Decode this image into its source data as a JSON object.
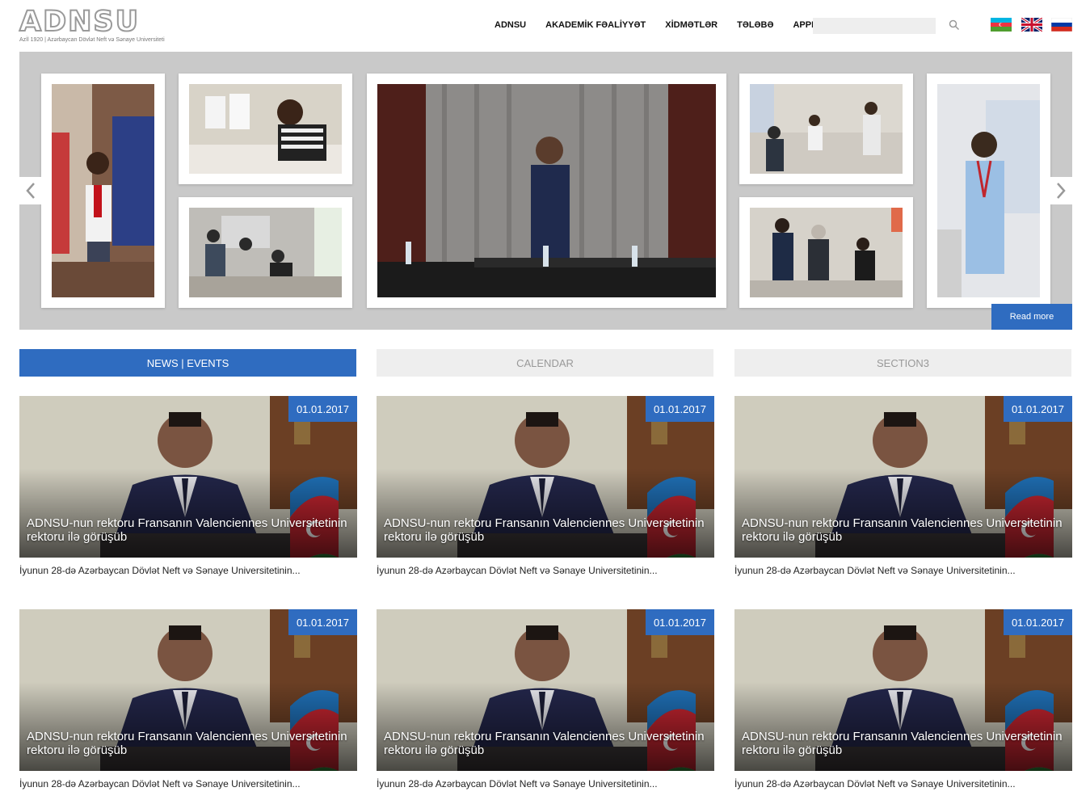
{
  "logo": {
    "mark": "ADNSU",
    "subtitle": "Azİl 1920 | Azərbaycan Dövlət Neft və Sənaye Universiteti"
  },
  "nav": {
    "items": [
      {
        "label": "ADNSU"
      },
      {
        "label": "AKADEMİK FƏALİYYƏT"
      },
      {
        "label": "XİDMƏTLƏR"
      },
      {
        "label": "TƏLƏBƏ"
      },
      {
        "label": "APPLY"
      }
    ]
  },
  "search": {
    "placeholder": "",
    "icon": "search-icon"
  },
  "languages": [
    {
      "code": "az",
      "icon": "flag-azerbaijan-icon"
    },
    {
      "code": "en",
      "icon": "flag-uk-icon"
    },
    {
      "code": "ru",
      "icon": "flag-russia-icon"
    }
  ],
  "slider": {
    "read_more_label": "Read more",
    "prev_icon": "chevron-left-icon",
    "next_icon": "chevron-right-icon"
  },
  "tabs": [
    {
      "label": "NEWS | EVENTS",
      "active": true
    },
    {
      "label": "CALENDAR",
      "active": false
    },
    {
      "label": "SECTION3",
      "active": false
    }
  ],
  "news": [
    {
      "date": "01.01.2017",
      "title": "ADNSU-nun rektoru Fransanın Valenciennes Universitetinin rektoru ilə görüşüb",
      "excerpt": "İyunun 28-də Azərbaycan Dövlət Neft və Sənaye Universitetinin..."
    },
    {
      "date": "01.01.2017",
      "title": "ADNSU-nun rektoru Fransanın Valenciennes Universitetinin rektoru ilə görüşüb",
      "excerpt": "İyunun 28-də Azərbaycan Dövlət Neft və Sənaye Universitetinin..."
    },
    {
      "date": "01.01.2017",
      "title": "ADNSU-nun rektoru Fransanın Valenciennes Universitetinin rektoru ilə görüşüb",
      "excerpt": "İyunun 28-də Azərbaycan Dövlət Neft və Sənaye Universitetinin..."
    },
    {
      "date": "01.01.2017",
      "title": "ADNSU-nun rektoru Fransanın Valenciennes Universitetinin rektoru ilə görüşüb",
      "excerpt": "İyunun 28-də Azərbaycan Dövlət Neft və Sənaye Universitetinin..."
    },
    {
      "date": "01.01.2017",
      "title": "ADNSU-nun rektoru Fransanın Valenciennes Universitetinin rektoru ilə görüşüb",
      "excerpt": "İyunun 28-də Azərbaycan Dövlət Neft və Sənaye Universitetinin..."
    },
    {
      "date": "01.01.2017",
      "title": "ADNSU-nun rektoru Fransanın Valenciennes Universitetinin rektoru ilə görüşüb",
      "excerpt": "İyunun 28-də Azərbaycan Dövlət Neft və Sənaye Universitetinin..."
    }
  ],
  "colors": {
    "accent": "#2f6cc0",
    "slider_bg": "#c9c9c9",
    "tab_inactive_bg": "#eeeeee"
  }
}
